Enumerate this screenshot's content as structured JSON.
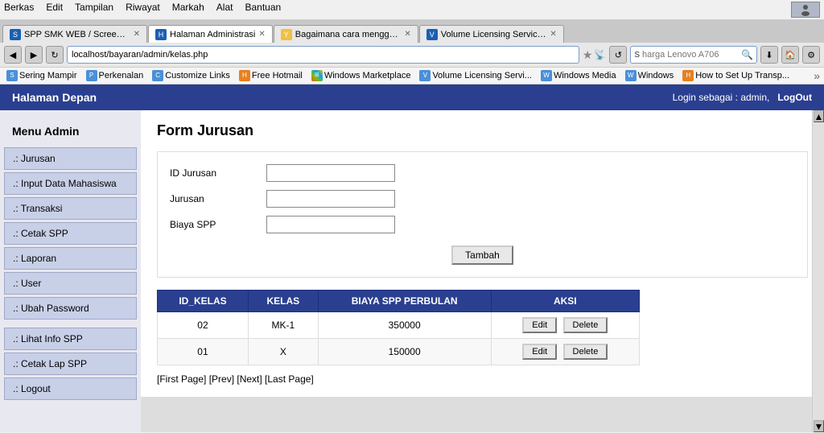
{
  "browser": {
    "menu_items": [
      "Berkas",
      "Edit",
      "Tampilan",
      "Riwayat",
      "Markah",
      "Alat",
      "Bantuan"
    ],
    "tabs": [
      {
        "label": "SPP SMK WEB / Screenshots",
        "active": false,
        "icon_color": "blue"
      },
      {
        "label": "Halaman Administrasi",
        "active": true,
        "icon_color": "blue"
      },
      {
        "label": "Bagaimana cara menggunakan mesin cuci...",
        "active": false,
        "icon_color": "yellow"
      },
      {
        "label": "Volume Licensing Service Center",
        "active": false,
        "icon_color": "blue"
      }
    ],
    "url": "localhost/bayaran/admin/kelas.php",
    "search_placeholder": "harga Lenovo A706",
    "bookmarks": [
      {
        "label": "Sering Mampir",
        "icon": "blue"
      },
      {
        "label": "Perkenalan",
        "icon": "blue"
      },
      {
        "label": "Customize Links",
        "icon": "blue"
      },
      {
        "label": "Free Hotmail",
        "icon": "orange"
      },
      {
        "label": "Windows Marketplace",
        "icon": "ms"
      },
      {
        "label": "Volume Licensing Servi...",
        "icon": "blue"
      },
      {
        "label": "Windows Media",
        "icon": "blue"
      },
      {
        "label": "Windows",
        "icon": "blue"
      },
      {
        "label": "How to Set Up Transp...",
        "icon": "orange"
      }
    ]
  },
  "page": {
    "header_title": "Halaman Depan",
    "login_text": "Login sebagai : admin,",
    "logout_label": "LogOut"
  },
  "sidebar": {
    "title": "Menu Admin",
    "items": [
      {
        "label": ".: Jurusan"
      },
      {
        "label": ".: Input Data Mahasiswa"
      },
      {
        "label": ".: Transaksi"
      },
      {
        "label": ".: Cetak SPP"
      },
      {
        "label": ".: Laporan"
      },
      {
        "label": ".: User"
      },
      {
        "label": ".: Ubah Password"
      },
      {
        "label": ".: Lihat Info SPP",
        "separator": true
      },
      {
        "label": ".: Cetak Lap SPP"
      },
      {
        "label": ".: Logout"
      }
    ]
  },
  "form": {
    "title": "Form Jurusan",
    "fields": [
      {
        "label": "ID Jurusan",
        "value": ""
      },
      {
        "label": "Jurusan",
        "value": ""
      },
      {
        "label": "Biaya SPP",
        "value": ""
      }
    ],
    "submit_label": "Tambah"
  },
  "table": {
    "headers": [
      "ID_KELAS",
      "KELAS",
      "BIAYA SPP PERBULAN",
      "AKSI"
    ],
    "rows": [
      {
        "id_kelas": "02",
        "kelas": "MK-1",
        "biaya": "350000"
      },
      {
        "id_kelas": "01",
        "kelas": "X",
        "biaya": "150000"
      }
    ],
    "edit_label": "Edit",
    "delete_label": "Delete"
  },
  "pagination": {
    "text": "[First Page] [Prev] [Next] [Last Page]"
  }
}
